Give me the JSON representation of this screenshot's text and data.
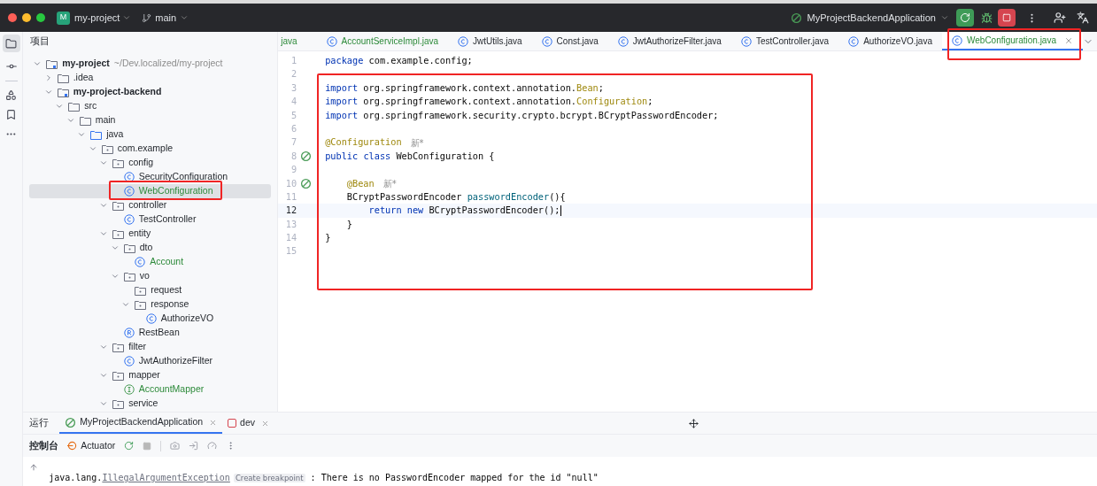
{
  "title_bar": {
    "project_badge": "M",
    "project": "my-project",
    "branch": "main",
    "run_config": "MyProjectBackendApplication"
  },
  "project_panel": {
    "title": "项目",
    "tree": [
      {
        "label": "my-project",
        "kind": "module",
        "hint": "~/Dev.localized/my-project",
        "expanded": true,
        "added": false,
        "selected": false,
        "children": [
          {
            "label": ".idea",
            "kind": "folder",
            "expanded": false,
            "added": false,
            "selected": false
          },
          {
            "label": "my-project-backend",
            "kind": "module",
            "expanded": true,
            "added": false,
            "selected": false,
            "children": [
              {
                "label": "src",
                "kind": "folder",
                "expanded": true,
                "added": false,
                "selected": false,
                "children": [
                  {
                    "label": "main",
                    "kind": "folder",
                    "expanded": true,
                    "added": false,
                    "selected": false,
                    "children": [
                      {
                        "label": "java",
                        "kind": "source",
                        "expanded": true,
                        "added": false,
                        "selected": false,
                        "children": [
                          {
                            "label": "com.example",
                            "kind": "package",
                            "expanded": true,
                            "added": false,
                            "selected": false,
                            "children": [
                              {
                                "label": "config",
                                "kind": "package",
                                "expanded": true,
                                "added": false,
                                "selected": false,
                                "children": [
                                  {
                                    "label": "SecurityConfiguration",
                                    "kind": "class",
                                    "added": false,
                                    "selected": false
                                  },
                                  {
                                    "label": "WebConfiguration",
                                    "kind": "class",
                                    "added": true,
                                    "selected": true
                                  }
                                ]
                              },
                              {
                                "label": "controller",
                                "kind": "package",
                                "expanded": true,
                                "added": false,
                                "selected": false,
                                "children": [
                                  {
                                    "label": "TestController",
                                    "kind": "class",
                                    "added": false,
                                    "selected": false
                                  }
                                ]
                              },
                              {
                                "label": "entity",
                                "kind": "package",
                                "expanded": true,
                                "added": false,
                                "selected": false,
                                "children": [
                                  {
                                    "label": "dto",
                                    "kind": "package",
                                    "expanded": true,
                                    "added": false,
                                    "selected": false,
                                    "children": [
                                      {
                                        "label": "Account",
                                        "kind": "class",
                                        "added": true,
                                        "selected": false
                                      }
                                    ]
                                  },
                                  {
                                    "label": "vo",
                                    "kind": "package",
                                    "expanded": true,
                                    "added": false,
                                    "selected": false,
                                    "children": [
                                      {
                                        "label": "request",
                                        "kind": "package",
                                        "added": false,
                                        "selected": false
                                      },
                                      {
                                        "label": "response",
                                        "kind": "package",
                                        "expanded": true,
                                        "added": false,
                                        "selected": false,
                                        "children": [
                                          {
                                            "label": "AuthorizeVO",
                                            "kind": "class",
                                            "added": false,
                                            "selected": false
                                          }
                                        ]
                                      }
                                    ]
                                  },
                                  {
                                    "label": "RestBean",
                                    "kind": "record",
                                    "added": false,
                                    "selected": false
                                  }
                                ]
                              },
                              {
                                "label": "filter",
                                "kind": "package",
                                "expanded": true,
                                "added": false,
                                "selected": false,
                                "children": [
                                  {
                                    "label": "JwtAuthorizeFilter",
                                    "kind": "class",
                                    "added": false,
                                    "selected": false
                                  }
                                ]
                              },
                              {
                                "label": "mapper",
                                "kind": "package",
                                "expanded": true,
                                "added": false,
                                "selected": false,
                                "children": [
                                  {
                                    "label": "AccountMapper",
                                    "kind": "interface",
                                    "added": true,
                                    "selected": false
                                  }
                                ]
                              },
                              {
                                "label": "service",
                                "kind": "package",
                                "expanded": true,
                                "added": false,
                                "selected": false
                              }
                            ]
                          }
                        ]
                      }
                    ]
                  }
                ]
              }
            ]
          }
        ]
      }
    ]
  },
  "editor": {
    "tabs": [
      {
        "label": "java",
        "added": true,
        "selected": false
      },
      {
        "label": "AccountServiceImpl.java",
        "kind": "class",
        "added": true,
        "selected": false
      },
      {
        "label": "JwtUtils.java",
        "kind": "class",
        "added": false,
        "selected": false
      },
      {
        "label": "Const.java",
        "kind": "class",
        "added": false,
        "selected": false
      },
      {
        "label": "JwtAuthorizeFilter.java",
        "kind": "class",
        "added": false,
        "selected": false
      },
      {
        "label": "TestController.java",
        "kind": "class",
        "added": false,
        "selected": false
      },
      {
        "label": "AuthorizeVO.java",
        "kind": "class",
        "added": false,
        "selected": false
      },
      {
        "label": "WebConfiguration.java",
        "kind": "class",
        "added": true,
        "selected": true
      }
    ],
    "lines": [
      {
        "number": "1",
        "tokens": [
          {
            "kind": "keyword",
            "text": "package"
          },
          {
            "kind": "plain",
            "text": " com.example.config;"
          }
        ]
      },
      {
        "number": "2"
      },
      {
        "number": "3",
        "tokens": [
          {
            "kind": "keyword",
            "text": "import"
          },
          {
            "kind": "plain",
            "text": " org.springframework.context.annotation."
          },
          {
            "kind": "annotation",
            "text": "Bean"
          },
          {
            "kind": "plain",
            "text": ";"
          }
        ]
      },
      {
        "number": "4",
        "tokens": [
          {
            "kind": "keyword",
            "text": "import"
          },
          {
            "kind": "plain",
            "text": " org.springframework.context.annotation."
          },
          {
            "kind": "annotation",
            "text": "Configuration"
          },
          {
            "kind": "plain",
            "text": ";"
          }
        ]
      },
      {
        "number": "5",
        "tokens": [
          {
            "kind": "keyword",
            "text": "import"
          },
          {
            "kind": "plain",
            "text": " org.springframework.security.crypto.bcrypt.BCryptPasswordEncoder;"
          }
        ]
      },
      {
        "number": "6"
      },
      {
        "number": "7",
        "tokens": [
          {
            "kind": "annotation",
            "text": "@Configuration"
          }
        ],
        "hint": "新*"
      },
      {
        "number": "8",
        "bean_marker": true,
        "tokens": [
          {
            "kind": "keyword",
            "text": "public "
          },
          {
            "kind": "keyword",
            "text": "class"
          },
          {
            "kind": "plain",
            "text": " WebConfiguration {"
          }
        ]
      },
      {
        "number": "9"
      },
      {
        "number": "10",
        "bean_marker": true,
        "tokens": [
          {
            "kind": "annotation",
            "text": "    @Bean"
          }
        ],
        "hint": "新*"
      },
      {
        "number": "11",
        "tokens": [
          {
            "kind": "plain",
            "text": "    BCryptPasswordEncoder "
          },
          {
            "kind": "method",
            "text": "passwordEncoder"
          },
          {
            "kind": "plain",
            "text": "(){"
          }
        ]
      },
      {
        "number": "12",
        "current": true,
        "tokens": [
          {
            "kind": "keyword",
            "text": "        return "
          },
          {
            "kind": "keyword",
            "text": "new"
          },
          {
            "kind": "plain",
            "text": " BCryptPasswordEncoder();"
          }
        ]
      },
      {
        "number": "13",
        "tokens": [
          {
            "kind": "plain",
            "text": "    }"
          }
        ]
      },
      {
        "number": "14",
        "tokens": [
          {
            "kind": "plain",
            "text": "}"
          }
        ]
      },
      {
        "number": "15"
      }
    ]
  },
  "run_panel": {
    "title": "运行",
    "tabs": [
      {
        "label": "MyProjectBackendApplication",
        "kind": "spring",
        "selected": true
      },
      {
        "label": "dev",
        "kind": "stopped",
        "selected": false
      }
    ],
    "console_tab": "控制台",
    "actuator": "Actuator",
    "console": {
      "prefix": "java.lang.",
      "link": "IllegalArgumentException",
      "hint": "Create breakpoint",
      "message": " : There is no PasswordEncoder mapped for the id \"null\""
    }
  }
}
